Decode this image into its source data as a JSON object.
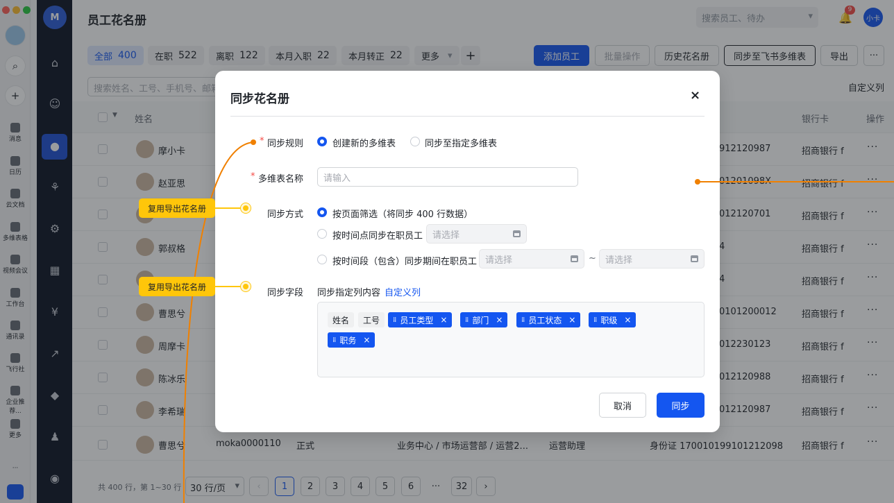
{
  "app": {
    "title": "员工花名册",
    "logo": "M"
  },
  "rail": {
    "items": [
      {
        "label": "消息",
        "icon": "message-icon"
      },
      {
        "label": "日历",
        "icon": "calendar-icon"
      },
      {
        "label": "云文档",
        "icon": "doc-icon"
      },
      {
        "label": "多维表格",
        "icon": "base-icon"
      },
      {
        "label": "视频会议",
        "icon": "video-icon"
      },
      {
        "label": "工作台",
        "icon": "workplace-icon"
      },
      {
        "label": "通讯录",
        "icon": "contacts-icon"
      },
      {
        "label": "飞行社",
        "icon": "moments-icon"
      },
      {
        "label": "企业推荐...",
        "icon": "recommend-icon"
      },
      {
        "label": "更多",
        "icon": "more-apps-icon"
      }
    ],
    "more": "···"
  },
  "header": {
    "search_placeholder": "搜索员工、待办",
    "notif_count": "9",
    "user_avatar": "小卡"
  },
  "filters": [
    {
      "label": "全部",
      "count": "400"
    },
    {
      "label": "在职",
      "count": "522"
    },
    {
      "label": "离职",
      "count": "122"
    },
    {
      "label": "本月入职",
      "count": "22"
    },
    {
      "label": "本月转正",
      "count": "22"
    },
    {
      "label": "更多",
      "count": ""
    }
  ],
  "actions": {
    "add": "添加员工",
    "batch": "批量操作",
    "history": "历史花名册",
    "sync": "同步至飞书多维表",
    "export": "导出",
    "more": "···"
  },
  "list_search_placeholder": "搜索姓名、工号、手机号、邮箱",
  "custom_columns": "自定义列",
  "table": {
    "headers": {
      "name": "姓名",
      "bank": "银行卡",
      "ops": "操作"
    },
    "rows": [
      {
        "name": "摩小卡",
        "id_tail": "912120987",
        "bank": "招商银行 f"
      },
      {
        "name": "赵亚思",
        "id_tail": "01201098X",
        "bank": "招商银行 f"
      },
      {
        "name": "",
        "id_tail": "012120701",
        "bank": "招商银行 f"
      },
      {
        "name": "郭叔格",
        "id_tail": "4",
        "bank": "招商银行 f"
      },
      {
        "name": "",
        "id_tail": "4",
        "bank": "招商银行 f"
      },
      {
        "name": "曹思兮",
        "id_tail": "0101200012",
        "bank": "招商银行 f"
      },
      {
        "name": "周摩卡",
        "id_tail": "012230123",
        "bank": "招商银行 f"
      },
      {
        "name": "陈冰乐",
        "id_tail": "012120988",
        "bank": "招商银行 f"
      },
      {
        "name": "李希瑞",
        "id_tail": "012120987",
        "bank": "招商银行 f"
      }
    ],
    "last_row": {
      "name": "曹思兮",
      "emp_id": "moka0000110",
      "status": "正式",
      "dept": "业务中心 / 市场运营部 / 运营2...",
      "position": "运营助理",
      "id_doc": "身份证 170010199101212098",
      "bank": "招商银行 f"
    }
  },
  "pagination": {
    "summary": "共 400 行，第 1~30 行",
    "page_size": "30 行/页",
    "pages": [
      "1",
      "2",
      "3",
      "4",
      "5",
      "6",
      "···",
      "32"
    ],
    "prev": "‹",
    "next": "›"
  },
  "modal": {
    "title": "同步花名册",
    "close": "×",
    "rule_label": "同步规则",
    "rule_options": [
      "创建新的多维表",
      "同步至指定多维表"
    ],
    "name_label": "多维表名称",
    "name_placeholder": "请输入",
    "mode_label": "同步方式",
    "mode_options": [
      "按页面筛选（将同步 400 行数据）",
      "按时间点同步在职员工",
      "按时间段（包含）同步期间在职员工"
    ],
    "date_placeholder": "请选择",
    "range_sep": "~",
    "field_label": "同步字段",
    "field_desc": "同步指定列内容",
    "field_link": "自定义列",
    "fixed_tags": [
      "姓名",
      "工号"
    ],
    "tags": [
      "员工类型",
      "部门",
      "员工状态",
      "职级",
      "职务"
    ],
    "cancel": "取消",
    "confirm": "同步"
  },
  "annotations": [
    "复用导出花名册",
    "复用导出花名册"
  ],
  "colors": {
    "primary": "#1456f0",
    "annotation": "#ffc60a",
    "connector": "#f08000",
    "sidebar": "#0b1323"
  }
}
